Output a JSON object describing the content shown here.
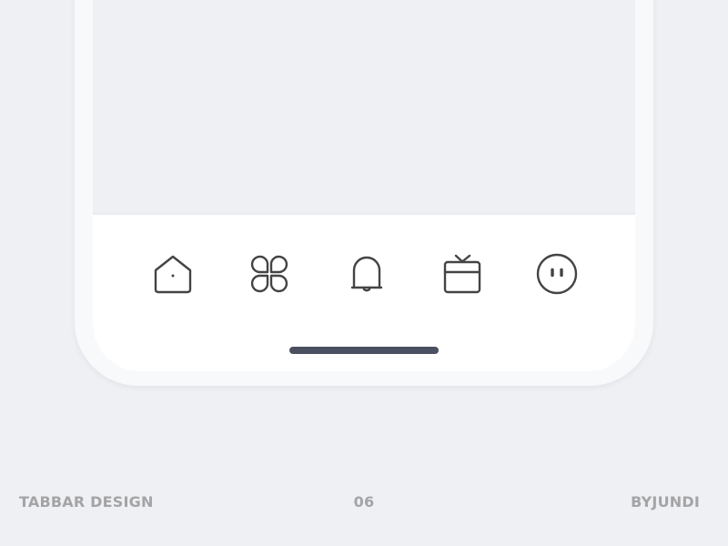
{
  "tabbar": {
    "tabs": [
      {
        "name": "home",
        "icon": "home-icon"
      },
      {
        "name": "apps",
        "icon": "clover-icon"
      },
      {
        "name": "notifications",
        "icon": "bell-icon"
      },
      {
        "name": "tv",
        "icon": "tv-icon"
      },
      {
        "name": "profile",
        "icon": "face-icon"
      }
    ],
    "icon_color": "#444444"
  },
  "footer": {
    "left": "TABBAR DESIGN",
    "center": "06",
    "right": "BYJUNDI"
  },
  "colors": {
    "background": "#eff0f4",
    "tabbar": "#ffffff",
    "home_indicator": "#4a5060",
    "footer_text": "#a4a4a6"
  }
}
